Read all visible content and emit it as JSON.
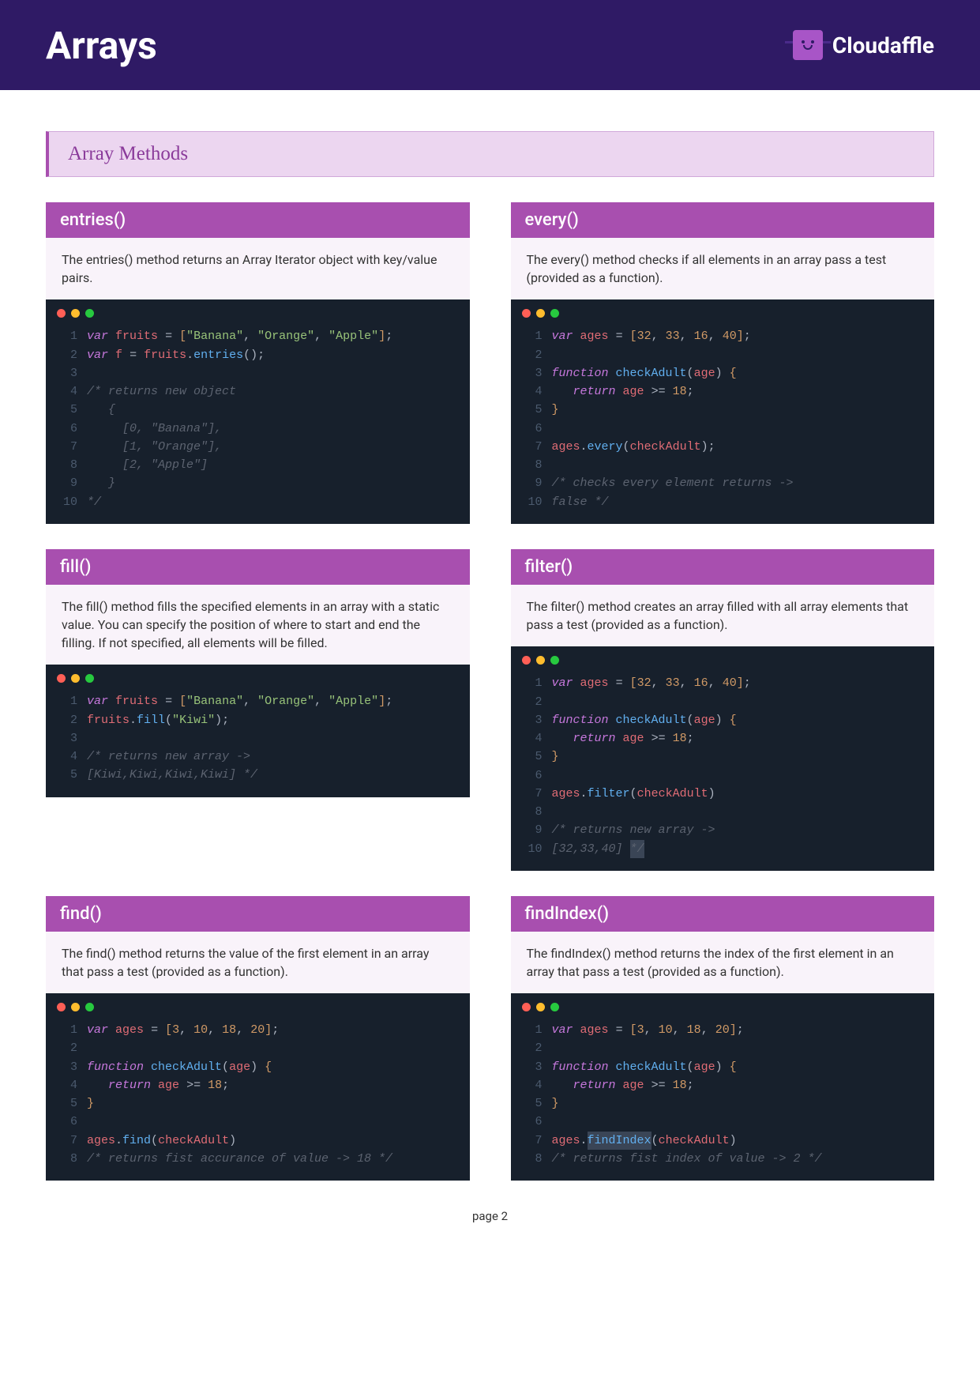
{
  "header": {
    "title": "Arrays",
    "brand": "Cloudaffle"
  },
  "section": {
    "title": "Array Methods"
  },
  "footer": {
    "text": "page 2"
  },
  "cards": [
    {
      "title": "entries()",
      "desc": "The entries() method returns an Array Iterator object with key/value pairs.",
      "code": [
        [
          [
            "kw",
            "var"
          ],
          [
            "pn",
            " "
          ],
          [
            "id",
            "fruits"
          ],
          [
            "pn",
            " "
          ],
          [
            "eq",
            "="
          ],
          [
            "pn",
            " "
          ],
          [
            "br",
            "["
          ],
          [
            "str",
            "\"Banana\""
          ],
          [
            "pn",
            ", "
          ],
          [
            "str",
            "\"Orange\""
          ],
          [
            "pn",
            ", "
          ],
          [
            "str",
            "\"Apple\""
          ],
          [
            "br",
            "]"
          ],
          [
            "pn",
            ";"
          ]
        ],
        [
          [
            "kw",
            "var"
          ],
          [
            "pn",
            " "
          ],
          [
            "id",
            "f"
          ],
          [
            "pn",
            " "
          ],
          [
            "eq",
            "="
          ],
          [
            "pn",
            " "
          ],
          [
            "id",
            "fruits"
          ],
          [
            "pn",
            "."
          ],
          [
            "fn",
            "entries"
          ],
          [
            "pn",
            "();"
          ]
        ],
        [],
        [
          [
            "cm",
            "/* returns new object"
          ]
        ],
        [
          [
            "cm",
            "   {"
          ]
        ],
        [
          [
            "cm",
            "     [0, \"Banana\"],"
          ]
        ],
        [
          [
            "cm",
            "     [1, \"Orange\"],"
          ]
        ],
        [
          [
            "cm",
            "     [2, \"Apple\"]"
          ]
        ],
        [
          [
            "cm",
            "   }"
          ]
        ],
        [
          [
            "cm",
            "*/"
          ]
        ]
      ]
    },
    {
      "title": "every()",
      "desc": "The every() method checks if all elements in an array pass a test (provided as a function).",
      "code": [
        [
          [
            "kw",
            "var"
          ],
          [
            "pn",
            " "
          ],
          [
            "id",
            "ages"
          ],
          [
            "pn",
            " "
          ],
          [
            "eq",
            "="
          ],
          [
            "pn",
            " "
          ],
          [
            "br",
            "["
          ],
          [
            "num",
            "32"
          ],
          [
            "pn",
            ", "
          ],
          [
            "num",
            "33"
          ],
          [
            "pn",
            ", "
          ],
          [
            "num",
            "16"
          ],
          [
            "pn",
            ", "
          ],
          [
            "num",
            "40"
          ],
          [
            "br",
            "]"
          ],
          [
            "pn",
            ";"
          ]
        ],
        [],
        [
          [
            "kw",
            "function"
          ],
          [
            "pn",
            " "
          ],
          [
            "fn",
            "checkAdult"
          ],
          [
            "pn",
            "("
          ],
          [
            "id",
            "age"
          ],
          [
            "pn",
            ") "
          ],
          [
            "br",
            "{"
          ]
        ],
        [
          [
            "pn",
            "   "
          ],
          [
            "kw",
            "return"
          ],
          [
            "pn",
            " "
          ],
          [
            "id",
            "age"
          ],
          [
            "pn",
            " "
          ],
          [
            "eq",
            ">="
          ],
          [
            "pn",
            " "
          ],
          [
            "num",
            "18"
          ],
          [
            "pn",
            ";"
          ]
        ],
        [
          [
            "br",
            "}"
          ]
        ],
        [],
        [
          [
            "id",
            "ages"
          ],
          [
            "pn",
            "."
          ],
          [
            "fn",
            "every"
          ],
          [
            "pn",
            "("
          ],
          [
            "id",
            "checkAdult"
          ],
          [
            "pn",
            ");"
          ]
        ],
        [],
        [
          [
            "cm",
            "/* checks every element returns ->"
          ]
        ],
        [
          [
            "cm",
            "false */"
          ]
        ]
      ]
    },
    {
      "title": "fill()",
      "desc": "The fill() method fills the specified elements in an array with a static value. You can specify the position of where to start and end the filling. If not specified, all elements will be filled.",
      "code": [
        [
          [
            "kw",
            "var"
          ],
          [
            "pn",
            " "
          ],
          [
            "id",
            "fruits"
          ],
          [
            "pn",
            " "
          ],
          [
            "eq",
            "="
          ],
          [
            "pn",
            " "
          ],
          [
            "br",
            "["
          ],
          [
            "str",
            "\"Banana\""
          ],
          [
            "pn",
            ", "
          ],
          [
            "str",
            "\"Orange\""
          ],
          [
            "pn",
            ", "
          ],
          [
            "str",
            "\"Apple\""
          ],
          [
            "br",
            "]"
          ],
          [
            "pn",
            ";"
          ]
        ],
        [
          [
            "id",
            "fruits"
          ],
          [
            "pn",
            "."
          ],
          [
            "fn",
            "fill"
          ],
          [
            "pn",
            "("
          ],
          [
            "str",
            "\"Kiwi\""
          ],
          [
            "pn",
            ");"
          ]
        ],
        [],
        [
          [
            "cm",
            "/* returns new array ->"
          ]
        ],
        [
          [
            "cm",
            "[Kiwi,Kiwi,Kiwi,Kiwi] */"
          ]
        ]
      ]
    },
    {
      "title": "filter()",
      "desc": "The filter() method creates an array filled with all array elements that pass a test (provided as a function).",
      "code": [
        [
          [
            "kw",
            "var"
          ],
          [
            "pn",
            " "
          ],
          [
            "id",
            "ages"
          ],
          [
            "pn",
            " "
          ],
          [
            "eq",
            "="
          ],
          [
            "pn",
            " "
          ],
          [
            "br",
            "["
          ],
          [
            "num",
            "32"
          ],
          [
            "pn",
            ", "
          ],
          [
            "num",
            "33"
          ],
          [
            "pn",
            ", "
          ],
          [
            "num",
            "16"
          ],
          [
            "pn",
            ", "
          ],
          [
            "num",
            "40"
          ],
          [
            "br",
            "]"
          ],
          [
            "pn",
            ";"
          ]
        ],
        [],
        [
          [
            "kw",
            "function"
          ],
          [
            "pn",
            " "
          ],
          [
            "fn",
            "checkAdult"
          ],
          [
            "pn",
            "("
          ],
          [
            "id",
            "age"
          ],
          [
            "pn",
            ") "
          ],
          [
            "br",
            "{"
          ]
        ],
        [
          [
            "pn",
            "   "
          ],
          [
            "kw",
            "return"
          ],
          [
            "pn",
            " "
          ],
          [
            "id",
            "age"
          ],
          [
            "pn",
            " "
          ],
          [
            "eq",
            ">="
          ],
          [
            "pn",
            " "
          ],
          [
            "num",
            "18"
          ],
          [
            "pn",
            ";"
          ]
        ],
        [
          [
            "br",
            "}"
          ]
        ],
        [],
        [
          [
            "id",
            "ages"
          ],
          [
            "pn",
            "."
          ],
          [
            "fn",
            "filter"
          ],
          [
            "pn",
            "("
          ],
          [
            "id",
            "checkAdult"
          ],
          [
            "pn",
            ")"
          ]
        ],
        [],
        [
          [
            "cm",
            "/* returns new array ->"
          ]
        ],
        [
          [
            "cm",
            "[32,33,40] "
          ],
          [
            "cmhl",
            "*/"
          ]
        ]
      ]
    },
    {
      "title": "find()",
      "desc": "The find() method returns the value of the first element in an array that pass a test (provided as a function).",
      "code": [
        [
          [
            "kw",
            "var"
          ],
          [
            "pn",
            " "
          ],
          [
            "id",
            "ages"
          ],
          [
            "pn",
            " "
          ],
          [
            "eq",
            "="
          ],
          [
            "pn",
            " "
          ],
          [
            "br",
            "["
          ],
          [
            "num",
            "3"
          ],
          [
            "pn",
            ", "
          ],
          [
            "num",
            "10"
          ],
          [
            "pn",
            ", "
          ],
          [
            "num",
            "18"
          ],
          [
            "pn",
            ", "
          ],
          [
            "num",
            "20"
          ],
          [
            "br",
            "]"
          ],
          [
            "pn",
            ";"
          ]
        ],
        [],
        [
          [
            "kw",
            "function"
          ],
          [
            "pn",
            " "
          ],
          [
            "fn",
            "checkAdult"
          ],
          [
            "pn",
            "("
          ],
          [
            "id",
            "age"
          ],
          [
            "pn",
            ") "
          ],
          [
            "br",
            "{"
          ]
        ],
        [
          [
            "pn",
            "   "
          ],
          [
            "kw",
            "return"
          ],
          [
            "pn",
            " "
          ],
          [
            "id",
            "age"
          ],
          [
            "pn",
            " "
          ],
          [
            "eq",
            ">="
          ],
          [
            "pn",
            " "
          ],
          [
            "num",
            "18"
          ],
          [
            "pn",
            ";"
          ]
        ],
        [
          [
            "br",
            "}"
          ]
        ],
        [],
        [
          [
            "id",
            "ages"
          ],
          [
            "pn",
            "."
          ],
          [
            "fn",
            "find"
          ],
          [
            "pn",
            "("
          ],
          [
            "id",
            "checkAdult"
          ],
          [
            "pn",
            ")"
          ]
        ],
        [
          [
            "cm",
            "/* returns fist accurance of value -> 18 */"
          ]
        ]
      ]
    },
    {
      "title": "findIndex()",
      "desc": "The findIndex() method returns the index of the first element in an array that pass a test (provided as a function).",
      "code": [
        [
          [
            "kw",
            "var"
          ],
          [
            "pn",
            " "
          ],
          [
            "id",
            "ages"
          ],
          [
            "pn",
            " "
          ],
          [
            "eq",
            "="
          ],
          [
            "pn",
            " "
          ],
          [
            "br",
            "["
          ],
          [
            "num",
            "3"
          ],
          [
            "pn",
            ", "
          ],
          [
            "num",
            "10"
          ],
          [
            "pn",
            ", "
          ],
          [
            "num",
            "18"
          ],
          [
            "pn",
            ", "
          ],
          [
            "num",
            "20"
          ],
          [
            "br",
            "]"
          ],
          [
            "pn",
            ";"
          ]
        ],
        [],
        [
          [
            "kw",
            "function"
          ],
          [
            "pn",
            " "
          ],
          [
            "fn",
            "checkAdult"
          ],
          [
            "pn",
            "("
          ],
          [
            "id",
            "age"
          ],
          [
            "pn",
            ") "
          ],
          [
            "br",
            "{"
          ]
        ],
        [
          [
            "pn",
            "   "
          ],
          [
            "kw",
            "return"
          ],
          [
            "pn",
            " "
          ],
          [
            "id",
            "age"
          ],
          [
            "pn",
            " "
          ],
          [
            "eq",
            ">="
          ],
          [
            "pn",
            " "
          ],
          [
            "num",
            "18"
          ],
          [
            "pn",
            ";"
          ]
        ],
        [
          [
            "br",
            "}"
          ]
        ],
        [],
        [
          [
            "id",
            "ages"
          ],
          [
            "pn",
            "."
          ],
          [
            "fnhl",
            "findIndex"
          ],
          [
            "pn",
            "("
          ],
          [
            "id",
            "checkAdult"
          ],
          [
            "pn",
            ")"
          ]
        ],
        [
          [
            "cm",
            "/* returns fist index of value -> 2 */"
          ]
        ]
      ]
    }
  ]
}
